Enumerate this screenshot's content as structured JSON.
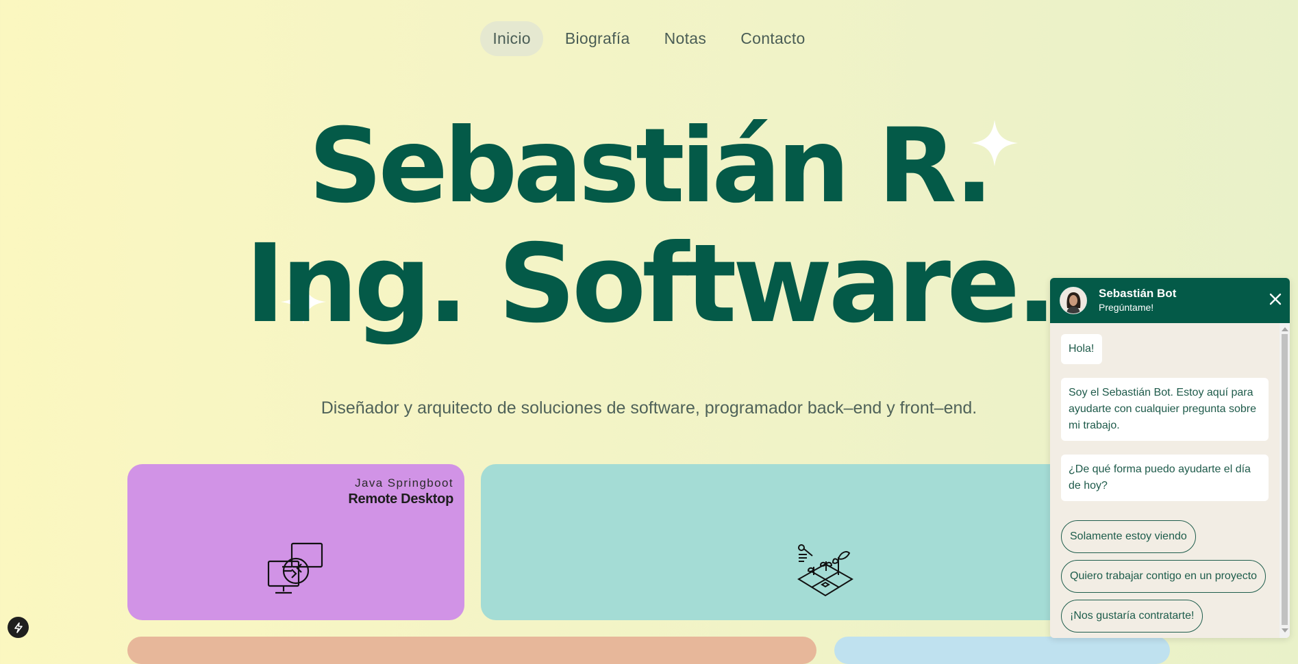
{
  "nav": {
    "items": [
      {
        "label": "Inicio",
        "active": true
      },
      {
        "label": "Biografía"
      },
      {
        "label": "Notas"
      },
      {
        "label": "Contacto"
      }
    ]
  },
  "hero": {
    "line1": "Sebastián R.",
    "line2": "Ing. Software.",
    "subtitle": "Diseñador y arquitecto de soluciones de software, programador back–end y front–end."
  },
  "cards": [
    {
      "kicker": "Java Springboot",
      "title": "Remote Desktop",
      "icon": "remote-desktop-icon",
      "color": "#d193e6"
    },
    {
      "icon": "smart-farm-icon",
      "color": "#a4dcd5"
    },
    {
      "color": "#e7b79a"
    },
    {
      "color": "#bfe1ef"
    }
  ],
  "chat": {
    "name": "Sebastián Bot",
    "subtitle": "Pregúntame!",
    "messages": [
      "Hola!",
      "Soy el Sebastián Bot. Estoy aquí para ayudarte con cualquier pregunta sobre mi trabajo.",
      "¿De qué forma puedo ayudarte el día de hoy?"
    ],
    "options": [
      "Solamente estoy viendo",
      "Quiero trabajar contigo en un proyecto",
      "¡Nos gustaría contratarte!"
    ]
  },
  "colors": {
    "brand": "#045a48",
    "text_muted": "#4f6259"
  }
}
